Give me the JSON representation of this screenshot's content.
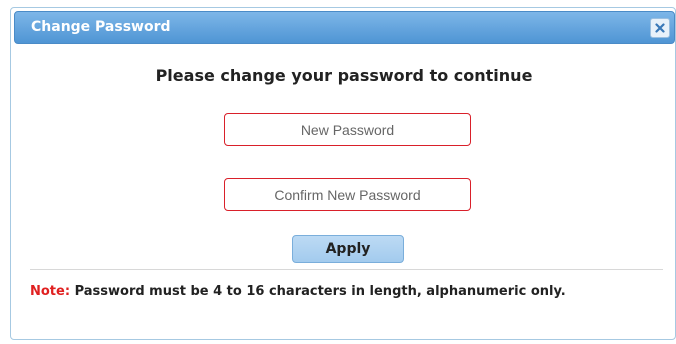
{
  "dialog": {
    "title": "Change Password",
    "close_icon": "close-icon",
    "heading": "Please change your password to continue",
    "new_password_placeholder": "New Password",
    "new_password_value": "",
    "confirm_password_placeholder": "Confirm New Password",
    "confirm_password_value": "",
    "apply_label": "Apply",
    "note_label": "Note:",
    "note_text": " Password must be 4 to 16 characters in length, alphanumeric only."
  },
  "colors": {
    "titlebar": "#4f95d4",
    "field_border": "#d9202a",
    "note_label": "#e02020",
    "apply_button": "#a3cbee"
  }
}
